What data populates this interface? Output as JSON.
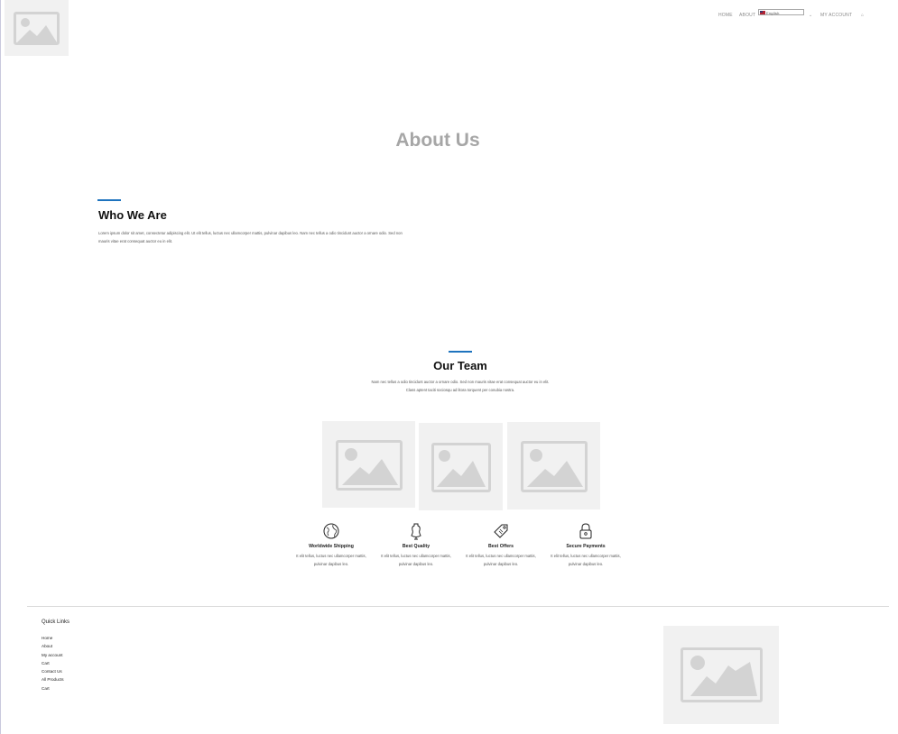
{
  "header": {
    "nav": {
      "home": "HOME",
      "about": "ABOUT",
      "language": "English",
      "my_account": "MY ACCOUNT"
    }
  },
  "page": {
    "title": "About Us"
  },
  "who_we_are": {
    "heading": "Who We Are",
    "text": "Lorem ipsum dolor sit amet, consectetur adipiscing elit. Ut elit tellus, luctus nec ullamcorper mattis, pulvinar dapibus leo. Nam nec tellus a odio tincidunt auctor a ornare odio. Sed non mauris vitae erat consequat auctor eu in elit."
  },
  "our_team": {
    "heading": "Our Team",
    "text_line1": "Nam nec tellus a odio tincidunt auctor a ornare odio. Sed non mauris vitae erat consequat auctor eu in elit.",
    "text_line2": "Class aptent taciti sociosqu ad litora torquent per conubia nostra."
  },
  "features": [
    {
      "icon": "globe-icon",
      "title": "Worldwide Shipping",
      "text": "It elit tellus, luctus nec ullamcorper mattis, pulvinar dapibus leo."
    },
    {
      "icon": "dress-form-icon",
      "title": "Best Quality",
      "text": "It elit tellus, luctus nec ullamcorper mattis, pulvinar dapibus leo."
    },
    {
      "icon": "price-tag-icon",
      "title": "Best Offers",
      "text": "It elit tellus, luctus nec ullamcorper mattis, pulvinar dapibus leo."
    },
    {
      "icon": "padlock-icon",
      "title": "Secure Payments",
      "text": "It elit tellus, luctus nec ullamcorper mattis, pulvinar dapibus leo."
    }
  ],
  "footer": {
    "quick_links_title": "Quick Links",
    "links": [
      "Home",
      "About",
      "My account",
      "Cart",
      "Contact Us",
      "All Products",
      "Cart"
    ]
  },
  "colors": {
    "accent": "#1e73be",
    "placeholder_bg": "#f1f1f1",
    "placeholder_fg": "#d3d3d3",
    "title_gray": "#a6a6a6"
  }
}
